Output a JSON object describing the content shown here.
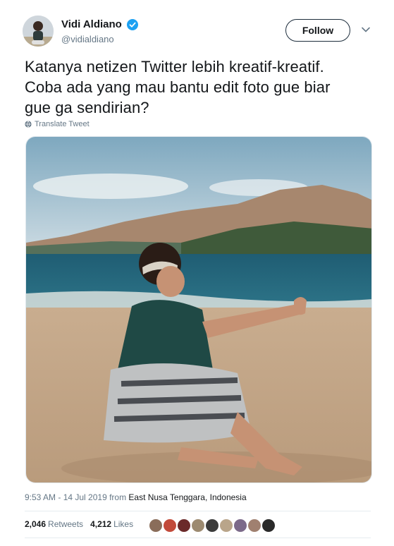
{
  "user": {
    "display_name": "Vidi Aldiano",
    "handle": "@vidialdiano",
    "verified": true,
    "follow_label": "Follow"
  },
  "tweet": {
    "line1": "Katanya netizen Twitter lebih kreatif-kreatif.",
    "line2": "Coba ada yang mau bantu edit foto gue biar",
    "line3": "gue ga sendirian?",
    "translate_label": "Translate Tweet"
  },
  "meta": {
    "time": "9:53 AM - 14 Jul 2019 from ",
    "location": "East Nusa Tenggara, Indonesia"
  },
  "stats": {
    "retweets_count": "2,046",
    "retweets_label": "Retweets",
    "likes_count": "4,212",
    "likes_label": "Likes"
  },
  "colors": {
    "brand_blue": "#1da1f2",
    "text_primary": "#14171a",
    "text_secondary": "#657786"
  },
  "likers": [
    "#8a6d5a",
    "#c24a3a",
    "#6b2a2a",
    "#9c8a70",
    "#3b3b3b",
    "#b9a58a",
    "#7c6a8a",
    "#a08070",
    "#2a2a2a"
  ]
}
